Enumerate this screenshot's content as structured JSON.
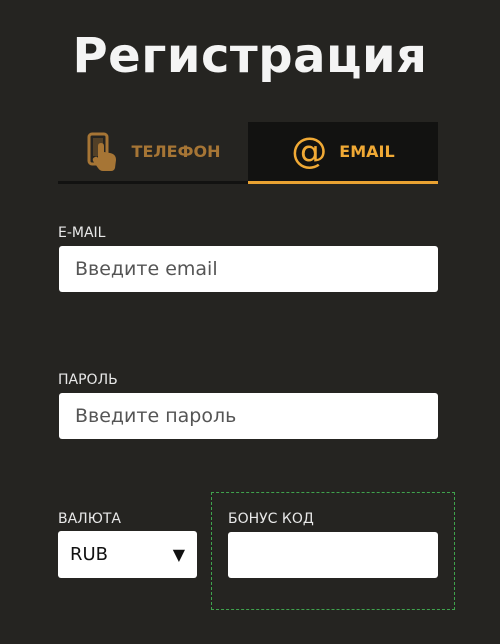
{
  "title": "Регистрация",
  "tabs": [
    {
      "label": "ТЕЛЕФОН",
      "icon": "phone-hand-icon",
      "active": false
    },
    {
      "label": "EMAIL",
      "icon": "at-icon",
      "active": true
    }
  ],
  "colors": {
    "background": "#252421",
    "accent": "#f0a935",
    "tab_dark": "#121211",
    "bonus_border": "#3fa34d"
  },
  "form": {
    "email": {
      "label": "E-MAIL",
      "placeholder": "Введите email",
      "value": ""
    },
    "password": {
      "label": "ПАРОЛЬ",
      "placeholder": "Введите пароль",
      "value": ""
    },
    "currency": {
      "label": "ВАЛЮТА",
      "value": "RUB"
    },
    "bonus": {
      "label": "БОНУС КОД",
      "value": ""
    }
  },
  "icons": {
    "at": "@",
    "dropdown": "▼"
  }
}
